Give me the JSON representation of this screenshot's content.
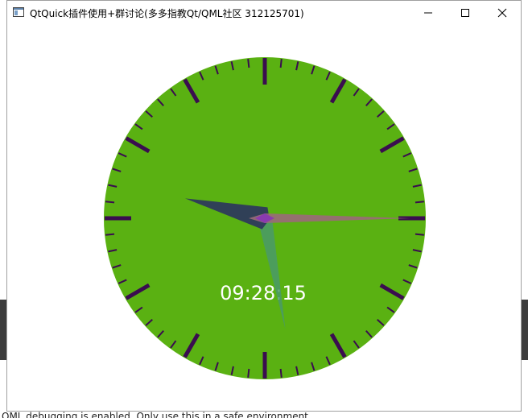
{
  "window": {
    "title": "QtQuick插件使用+群讨论(多多指教Qt/QML社区 312125701)",
    "buttons": {
      "minimize": "minimize",
      "maximize": "maximize",
      "close": "close"
    }
  },
  "background": {
    "console_text": "QML debugging is enabled. Only use this in a safe environment."
  },
  "clock": {
    "time_text": "09:28:15",
    "hours": 9,
    "minutes": 28,
    "seconds": 15,
    "colors": {
      "face": "#5ab112",
      "ticks": "#3a0d4f",
      "hour_hand": "#2e3a5c",
      "minute_hand": "#4a9a6a",
      "second_hand": "#9a6a7a",
      "center": "#8a3ab0",
      "time_text": "#ffffff"
    }
  }
}
